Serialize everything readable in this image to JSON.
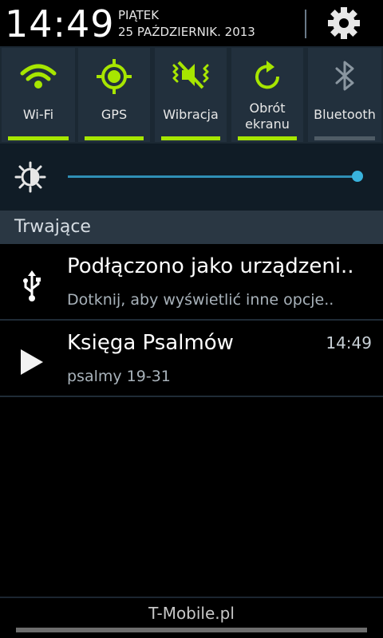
{
  "status": {
    "time": "14:49",
    "day": "PIĄTEK",
    "date": "25 PAŹDZIERNIK. 2013"
  },
  "quick_settings": [
    {
      "label": "Wi-Fi",
      "icon": "wifi-icon",
      "active": true
    },
    {
      "label": "GPS",
      "icon": "gps-icon",
      "active": true
    },
    {
      "label": "Wibracja",
      "icon": "vibrate-icon",
      "active": true
    },
    {
      "label_line1": "Obrót",
      "label_line2": "ekranu",
      "icon": "rotate-icon",
      "active": true
    },
    {
      "label": "Bluetooth",
      "icon": "bluetooth-icon",
      "active": false
    }
  ],
  "brightness": {
    "level": 1.0
  },
  "section": {
    "title": "Trwające"
  },
  "notifications": [
    {
      "icon": "usb-icon",
      "title": "Podłączono jako urządzeni..",
      "subtitle": "Dotknij, aby wyświetlić inne opcje.."
    },
    {
      "icon": "play-icon",
      "title": "Księga Psalmów",
      "subtitle": "psalmy 19-31",
      "time": "14:49"
    }
  ],
  "footer": {
    "carrier": "T-Mobile.pl"
  },
  "colors": {
    "accent": "#a7e600",
    "off": "#4f5c66",
    "slider": "#39b3dd"
  }
}
